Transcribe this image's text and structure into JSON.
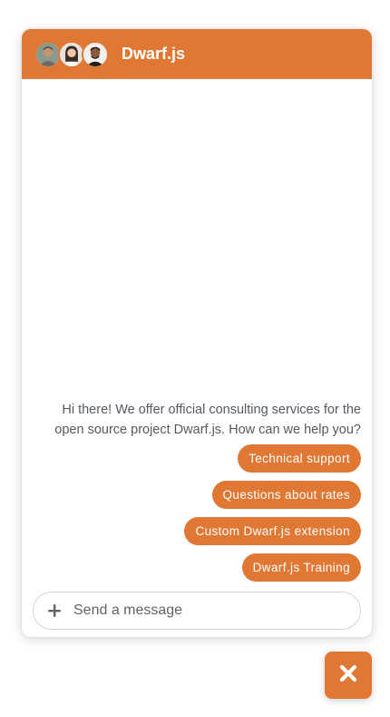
{
  "brand": {
    "accent": "#e07834"
  },
  "header": {
    "title": "Dwarf.js",
    "avatars": [
      "agent-avatar-1",
      "agent-avatar-2",
      "agent-avatar-3"
    ]
  },
  "conversation": {
    "intro_message": "Hi there! We offer official consulting services for the open source project Dwarf.js. How can we help you?",
    "quick_replies": [
      "Technical support",
      "Questions about rates",
      "Custom Dwarf.js extension",
      "Dwarf.js Training"
    ]
  },
  "composer": {
    "placeholder": "Send a message",
    "attach_icon": "plus-icon"
  },
  "launcher": {
    "icon": "close-icon"
  }
}
